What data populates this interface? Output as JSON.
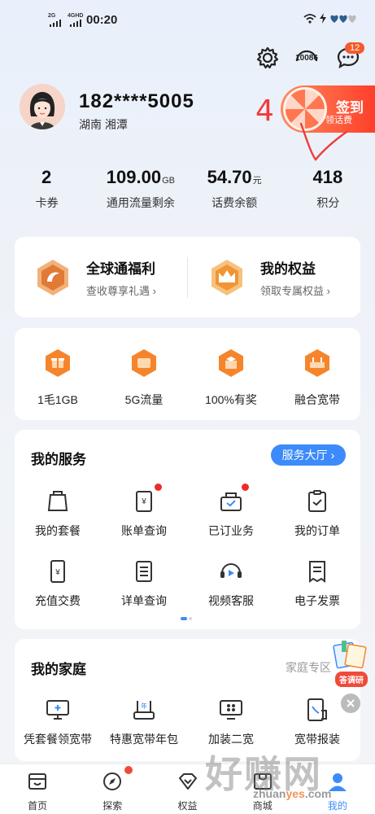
{
  "status_bar": {
    "net1": "2G",
    "net2": "4GHD",
    "time": "00:20"
  },
  "header": {
    "service_icon_label": "10086",
    "message_count": "12"
  },
  "profile": {
    "phone": "182****5005",
    "region": "湖南  湘潭"
  },
  "signin": {
    "label": "签到",
    "sub": "领话费"
  },
  "annotation": "4",
  "stats": [
    {
      "value": "2",
      "unit": "",
      "label": "卡券"
    },
    {
      "value": "109.00",
      "unit": "GB",
      "label": "通用流量剩余"
    },
    {
      "value": "54.70",
      "unit": "元",
      "label": "话费余额"
    },
    {
      "value": "418",
      "unit": "",
      "label": "积分"
    }
  ],
  "benefits": [
    {
      "title": "全球通福利",
      "sub": "查收尊享礼遇 ›"
    },
    {
      "title": "我的权益",
      "sub": "领取专属权益 ›"
    }
  ],
  "promos": [
    {
      "label": "1毛1GB",
      "icon": "gift-icon"
    },
    {
      "label": "5G流量",
      "icon": "5g-icon"
    },
    {
      "label": "100%有奖",
      "icon": "prize-icon"
    },
    {
      "label": "融合宽带",
      "icon": "router-icon"
    }
  ],
  "services": {
    "title": "我的服务",
    "hall_label": "服务大厅",
    "items": [
      {
        "label": "我的套餐",
        "icon": "package-icon",
        "dot": false
      },
      {
        "label": "账单查询",
        "icon": "bill-icon",
        "dot": true
      },
      {
        "label": "已订业务",
        "icon": "subscribed-icon",
        "dot": true
      },
      {
        "label": "我的订单",
        "icon": "order-icon",
        "dot": false
      },
      {
        "label": "充值交费",
        "icon": "recharge-icon",
        "dot": false
      },
      {
        "label": "详单查询",
        "icon": "detail-list-icon",
        "dot": false
      },
      {
        "label": "视频客服",
        "icon": "video-support-icon",
        "dot": false
      },
      {
        "label": "电子发票",
        "icon": "invoice-icon",
        "dot": false
      }
    ]
  },
  "family": {
    "title": "我的家庭",
    "zone_label": "家庭专区",
    "survey_label": "答调研",
    "items": [
      {
        "label": "凭套餐领宽带",
        "icon": "monitor-icon"
      },
      {
        "label": "特惠宽带年包",
        "icon": "router-year-icon"
      },
      {
        "label": "加装二宽",
        "icon": "tv-icon"
      },
      {
        "label": "宽带报装",
        "icon": "phone-install-icon"
      }
    ]
  },
  "tabbar": [
    {
      "label": "首页",
      "icon": "home-icon"
    },
    {
      "label": "探索",
      "icon": "compass-icon"
    },
    {
      "label": "权益",
      "icon": "diamond-icon"
    },
    {
      "label": "商城",
      "icon": "shop-icon"
    },
    {
      "label": "我的",
      "icon": "person-icon"
    }
  ],
  "watermark": {
    "main": "好赚网",
    "url_a": "zhuan",
    "url_b": "yes",
    "url_c": ".com"
  },
  "colors": {
    "accent": "#3d8bfa",
    "orange": "#f5852c",
    "red": "#ee2b2b"
  }
}
